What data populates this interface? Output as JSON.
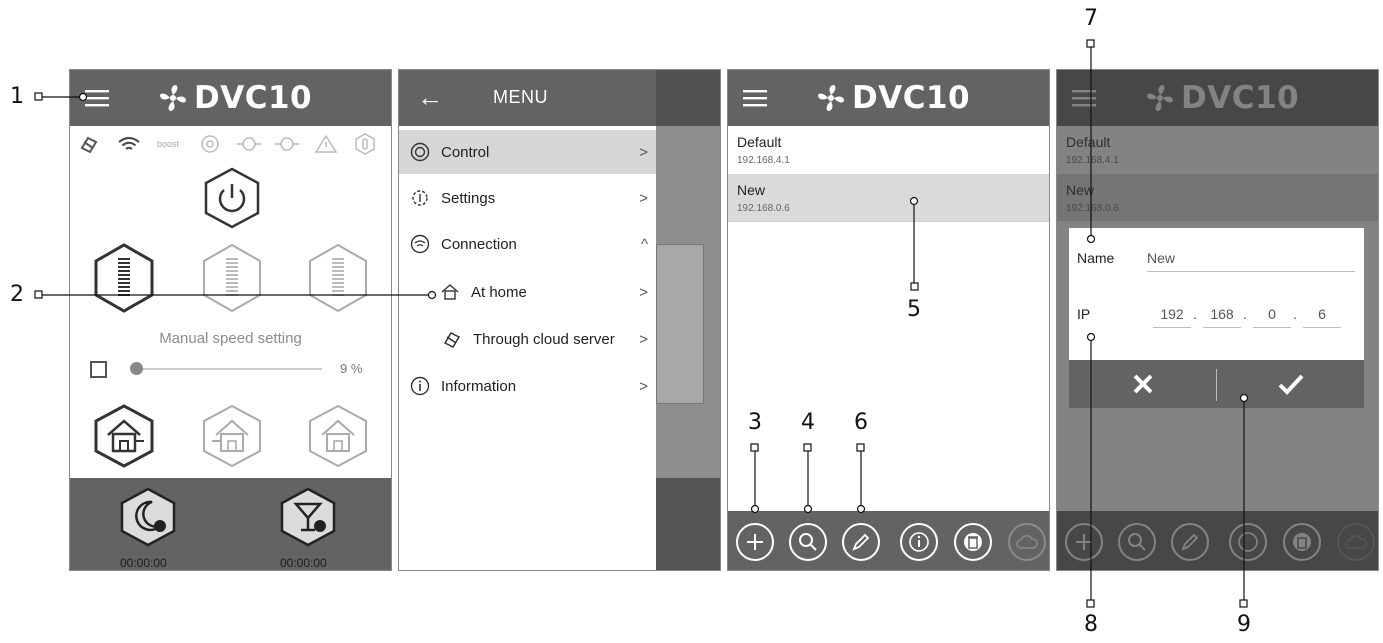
{
  "brand": "DVC10",
  "screen1": {
    "status_boost": "boost",
    "speed_label": "Manual speed setting",
    "speed_value": "9 %",
    "timer_night": "00:00:00",
    "timer_party": "00:00:00"
  },
  "menu": {
    "title": "MENU",
    "items": [
      {
        "label": "Control"
      },
      {
        "label": "Settings"
      },
      {
        "label": "Connection"
      },
      {
        "label": "At home"
      },
      {
        "label": "Through cloud server"
      },
      {
        "label": "Information"
      }
    ]
  },
  "devices": [
    {
      "name": "Default",
      "ip": "192.168.4.1"
    },
    {
      "name": "New",
      "ip": "192.168.0.6"
    }
  ],
  "dialog": {
    "name_label": "Name",
    "name_value": "New",
    "ip_label": "IP",
    "ip": [
      "192",
      "168",
      "0",
      "6"
    ],
    "ip_sep": "."
  },
  "callouts": [
    "1",
    "2",
    "3",
    "4",
    "5",
    "6",
    "7",
    "8",
    "9"
  ],
  "colors": {
    "header": "#636363",
    "selected": "#dadada",
    "background": "#ffffff"
  },
  "icons": {
    "header": [
      "menu-icon",
      "fan-logo-icon",
      "back-arrow-icon"
    ],
    "toolbar": [
      "plus-icon",
      "search-icon",
      "pencil-icon",
      "info-icon",
      "trash-icon",
      "cloud-icon"
    ]
  }
}
